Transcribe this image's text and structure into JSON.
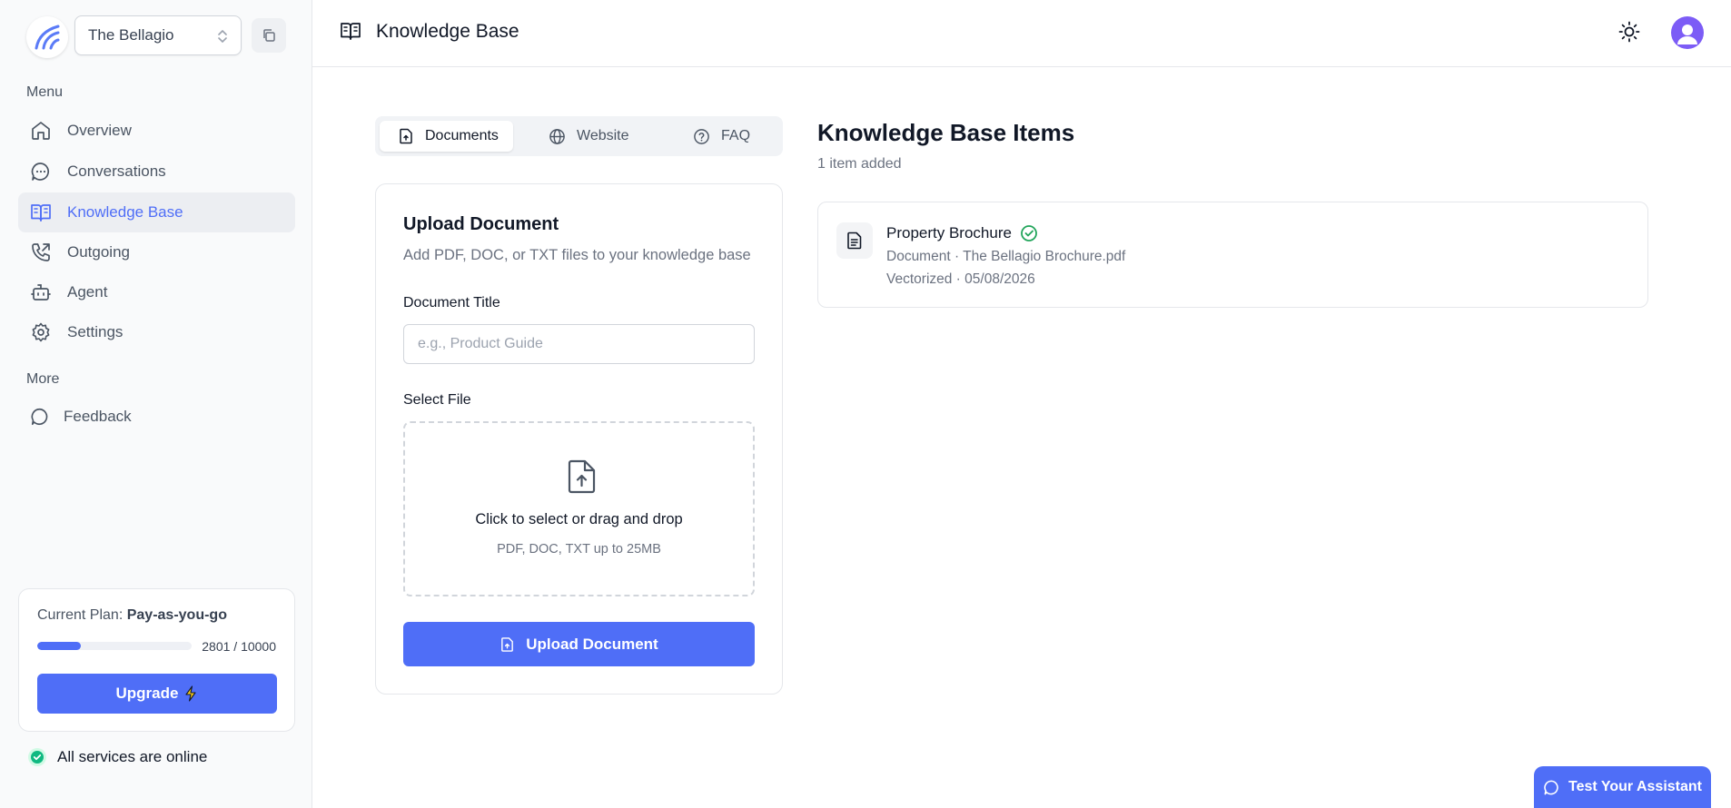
{
  "org": {
    "name": "The Bellagio"
  },
  "sidebar": {
    "menu_label": "Menu",
    "items": [
      {
        "label": "Overview",
        "icon": "home-icon"
      },
      {
        "label": "Conversations",
        "icon": "chat-bubble-icon"
      },
      {
        "label": "Knowledge Base",
        "icon": "book-icon",
        "active": true
      },
      {
        "label": "Outgoing",
        "icon": "phone-outgoing-icon"
      },
      {
        "label": "Agent",
        "icon": "bot-icon"
      },
      {
        "label": "Settings",
        "icon": "gear-icon"
      }
    ],
    "more_label": "More",
    "more_items": [
      {
        "label": "Feedback",
        "icon": "message-circle-icon"
      }
    ]
  },
  "plan": {
    "prefix": "Current Plan: ",
    "name": "Pay-as-you-go",
    "usage_text": "2801 / 10000",
    "used": 2801,
    "limit": 10000,
    "upgrade_label": "Upgrade",
    "upgrade_icon": "lightning-icon"
  },
  "status": {
    "text": "All services are online",
    "color": "#10b981"
  },
  "header": {
    "title": "Knowledge Base"
  },
  "tabs": [
    {
      "label": "Documents",
      "icon": "file-upload-icon",
      "active": true
    },
    {
      "label": "Website",
      "icon": "globe-icon"
    },
    {
      "label": "FAQ",
      "icon": "help-circle-icon"
    }
  ],
  "upload": {
    "title": "Upload Document",
    "subtitle": "Add PDF, DOC, or TXT files to your knowledge base",
    "doc_title_label": "Document Title",
    "doc_title_placeholder": "e.g., Product Guide",
    "doc_title_value": "",
    "file_label": "Select File",
    "drop_text": "Click to select or drag and drop",
    "drop_hint": "PDF, DOC, TXT up to 25MB",
    "button_label": "Upload Document"
  },
  "items": {
    "title": "Knowledge Base Items",
    "count_text": "1 item added",
    "list": [
      {
        "name": "Property Brochure",
        "source": "Document · The Bellagio Brochure.pdf",
        "status": "Vectorized · 05/08/2026",
        "status_color": "#22a55b"
      }
    ]
  },
  "test_button": {
    "label": "Test Your Assistant"
  },
  "colors": {
    "accent": "#4f6ef7",
    "avatar": "#7c5cf6",
    "success": "#22a55b"
  }
}
